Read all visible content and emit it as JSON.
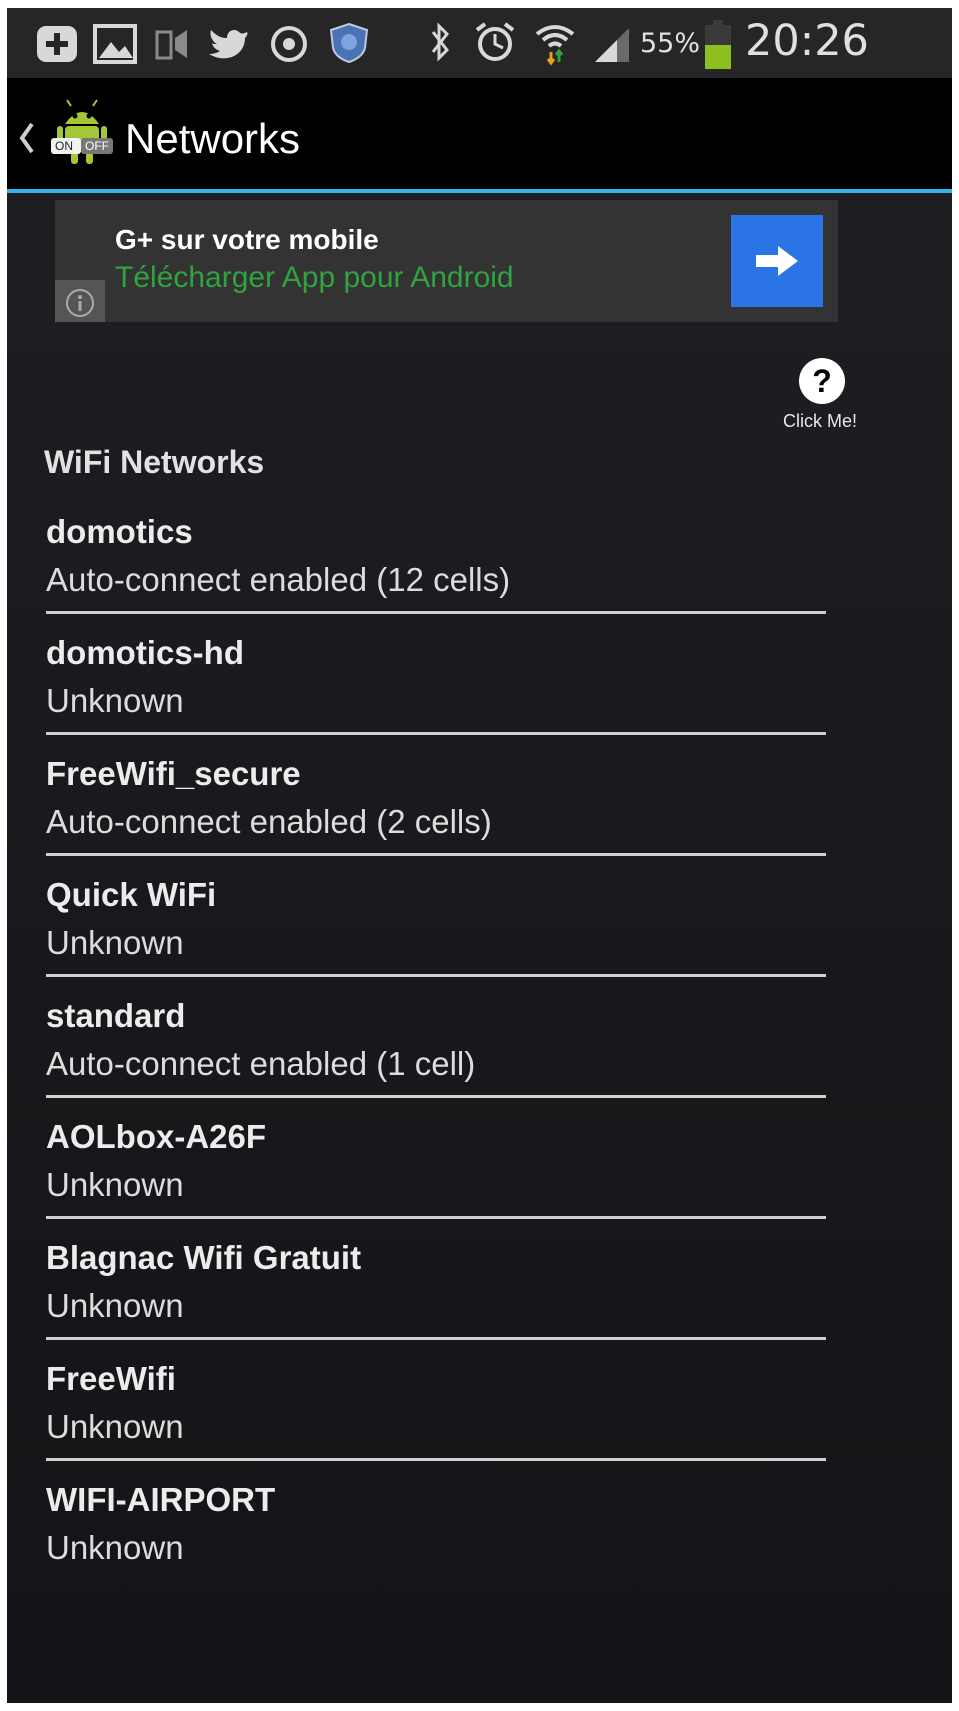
{
  "status_bar": {
    "battery": "55%",
    "time": "20:26",
    "icons": [
      "plus-icon",
      "gallery-icon",
      "cast-icon",
      "twitter-icon",
      "target-icon",
      "shield-icon",
      "bluetooth-icon",
      "alarm-icon",
      "wifi-icon",
      "signal-icon",
      "battery-icon"
    ]
  },
  "action_bar": {
    "title": "Networks",
    "app_icon_label_on": "ON",
    "app_icon_label_off": "OFF"
  },
  "ad": {
    "title": "G+ sur votre mobile",
    "subtitle": "Télécharger App pour Android"
  },
  "help": {
    "label": "Click Me!",
    "glyph": "?"
  },
  "section_title": "WiFi Networks",
  "networks": [
    {
      "name": "domotics",
      "status": "Auto-connect enabled (12 cells)"
    },
    {
      "name": "domotics-hd",
      "status": "Unknown"
    },
    {
      "name": "FreeWifi_secure",
      "status": "Auto-connect enabled (2 cells)"
    },
    {
      "name": "Quick WiFi",
      "status": "Unknown"
    },
    {
      "name": "standard",
      "status": "Auto-connect enabled (1 cell)"
    },
    {
      "name": "AOLbox-A26F",
      "status": "Unknown"
    },
    {
      "name": "Blagnac Wifi Gratuit",
      "status": "Unknown"
    },
    {
      "name": "FreeWifi",
      "status": "Unknown"
    },
    {
      "name": "WIFI-AIRPORT",
      "status": "Unknown"
    }
  ],
  "colors": {
    "accent": "#33b5e5",
    "ad_button": "#2b74e6",
    "ad_subtitle": "#2fa340"
  }
}
